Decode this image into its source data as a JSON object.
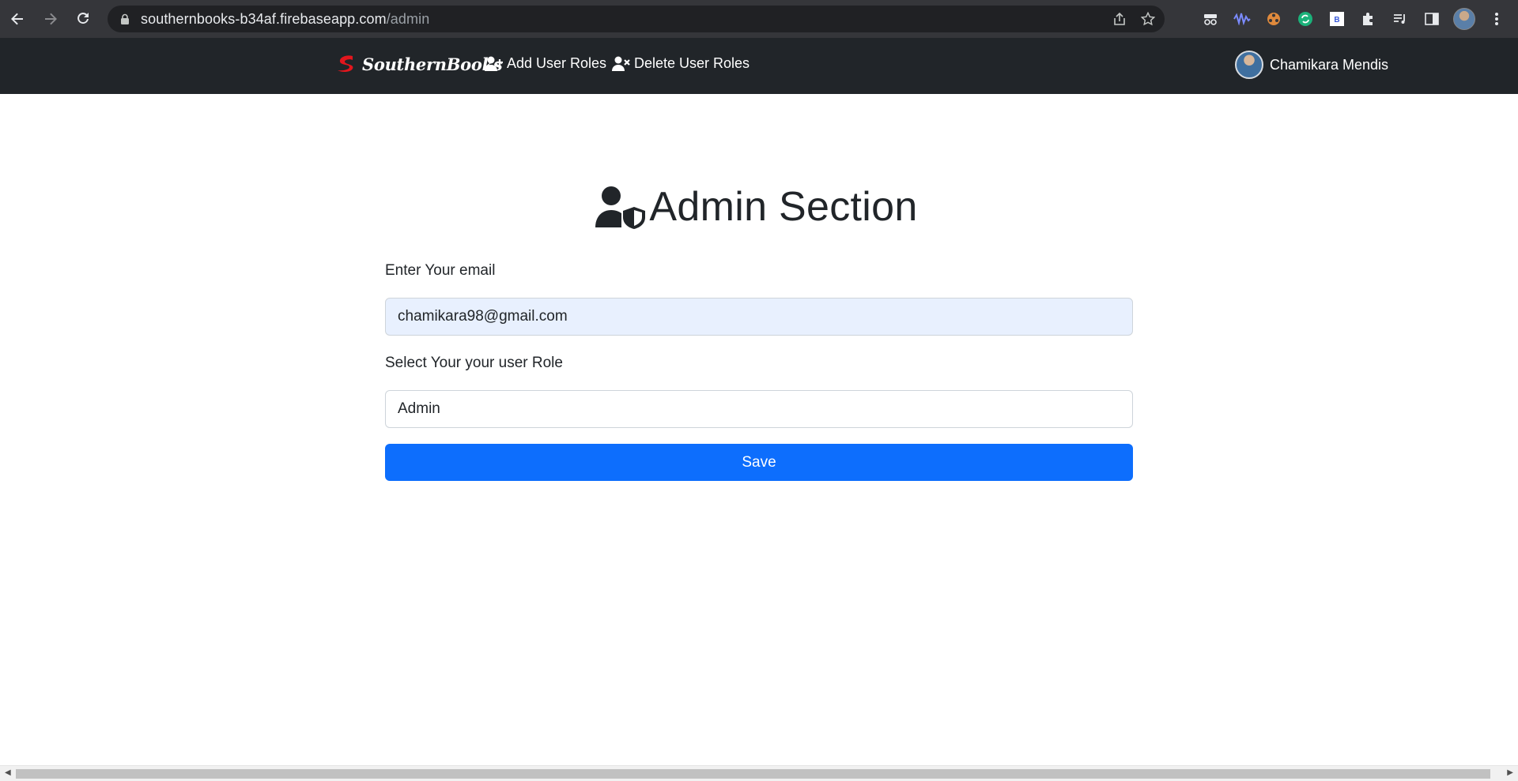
{
  "browser": {
    "url_host": "southernbooks-b34af.firebaseapp.com",
    "url_path": "/admin",
    "back_icon": "back-arrow-icon",
    "forward_icon": "forward-arrow-icon",
    "reload_icon": "reload-icon"
  },
  "navbar": {
    "brand": "SouthernBooks",
    "links": [
      {
        "label": "Add User Roles",
        "icon": "user-plus-icon"
      },
      {
        "label": "Delete User Roles",
        "icon": "user-xmark-icon"
      }
    ],
    "user_name": "Chamikara Mendis"
  },
  "main": {
    "title": "Admin Section",
    "email_label": "Enter Your email",
    "email_value": "chamikara98@gmail.com",
    "role_label": "Select Your your user Role",
    "role_value": "Admin",
    "save_label": "Save"
  },
  "colors": {
    "navbar_bg": "#212529",
    "primary": "#0d6efd",
    "autofill_bg": "#e8f0fe",
    "brand_logo_red": "#e3161d"
  }
}
